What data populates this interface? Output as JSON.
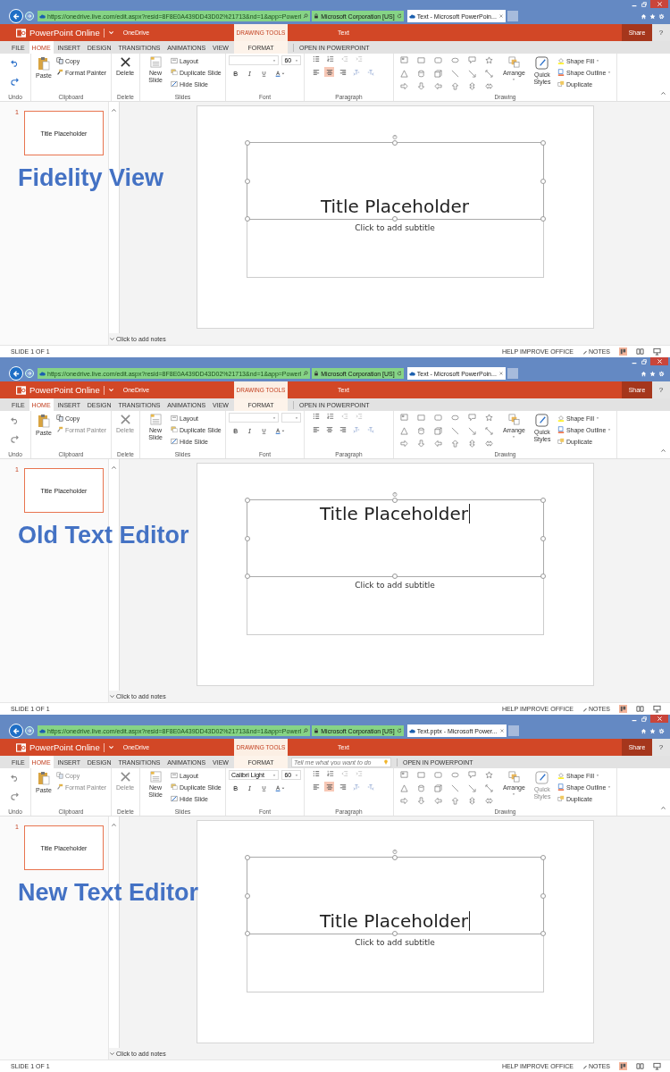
{
  "panels": [
    {
      "caption": "Fidelity View",
      "browser": {
        "url": "https://onedrive.live.com/edit.aspx?resid=8F8E0A439DD43D02%21713&nd=1&app=Powerl",
        "site_identity": "Microsoft Corporation [US]",
        "tab_title": "Text - Microsoft PowerPoin..."
      },
      "app": {
        "name": "PowerPoint Online",
        "location": "OneDrive",
        "context_label": "DRAWING TOOLS",
        "document": "Text",
        "share": "Share",
        "help": "?"
      },
      "tabs": [
        {
          "label": "FILE",
          "kind": "standard",
          "selected": false
        },
        {
          "label": "HOME",
          "kind": "standard",
          "selected": true
        },
        {
          "label": "INSERT",
          "kind": "standard",
          "selected": false
        },
        {
          "label": "DESIGN",
          "kind": "standard",
          "selected": false
        },
        {
          "label": "TRANSITIONS",
          "kind": "standard",
          "selected": false
        },
        {
          "label": "ANIMATIONS",
          "kind": "standard",
          "selected": false
        },
        {
          "label": "VIEW",
          "kind": "standard",
          "selected": false
        },
        {
          "label": "FORMAT",
          "kind": "contextual",
          "selected": false
        }
      ],
      "open_in_app": "OPEN IN POWERPOINT",
      "ribbon": {
        "undo": {
          "label": "Undo",
          "undo_disabled": false,
          "redo_disabled": false
        },
        "clipboard": {
          "label": "Clipboard",
          "paste": {
            "label": "Paste",
            "disabled": false
          },
          "copy": {
            "label": "Copy",
            "disabled": false
          },
          "format_painter": {
            "label": "Format Painter",
            "disabled": false
          }
        },
        "delete": {
          "label": "Delete",
          "button": {
            "label": "Delete",
            "disabled": false
          }
        },
        "slides": {
          "label": "Slides",
          "new_slide": "New Slide",
          "layout": "Layout",
          "duplicate_slide": "Duplicate Slide",
          "hide_slide": "Hide Slide"
        },
        "font": {
          "label": "Font",
          "size": "60"
        },
        "paragraph": {
          "label": "Paragraph",
          "alignment": [
            {
              "kind": "left",
              "selected": false
            },
            {
              "kind": "center",
              "selected": true
            },
            {
              "kind": "right",
              "selected": false
            }
          ]
        },
        "drawing": {
          "label": "Drawing",
          "arrange": "Arrange",
          "quick_styles": {
            "label": "Quick Styles",
            "disabled": false
          },
          "shape_fill": "Shape Fill",
          "shape_outline": "Shape Outline",
          "duplicate": "Duplicate"
        }
      },
      "thumbnail": {
        "number": "1",
        "title": "Title Placeholder"
      },
      "slide": {
        "title": "Title Placeholder",
        "subtitle": "Click to add subtitle",
        "title_at_bottom": true,
        "cursor": false
      },
      "notes": "Click to add notes",
      "status": {
        "slide": "SLIDE 1 OF 1",
        "help": "HELP IMPROVE OFFICE",
        "notes": "NOTES"
      }
    },
    {
      "caption": "Old Text Editor",
      "browser": {
        "url": "https://onedrive.live.com/edit.aspx?resid=8F8E0A439DD43D02%21713&nd=1&app=Powerl",
        "site_identity": "Microsoft Corporation [US]",
        "tab_title": "Text - Microsoft PowerPoin..."
      },
      "app": {
        "name": "PowerPoint Online",
        "location": "OneDrive",
        "context_label": "DRAWING TOOLS",
        "document": "Text",
        "share": "Share",
        "help": "?"
      },
      "tabs": [
        {
          "label": "FILE",
          "kind": "standard",
          "selected": false
        },
        {
          "label": "HOME",
          "kind": "standard",
          "selected": true
        },
        {
          "label": "INSERT",
          "kind": "standard",
          "selected": false
        },
        {
          "label": "DESIGN",
          "kind": "standard",
          "selected": false
        },
        {
          "label": "TRANSITIONS",
          "kind": "standard",
          "selected": false
        },
        {
          "label": "ANIMATIONS",
          "kind": "standard",
          "selected": false
        },
        {
          "label": "VIEW",
          "kind": "standard",
          "selected": false
        },
        {
          "label": "FORMAT",
          "kind": "contextual",
          "selected": false
        }
      ],
      "open_in_app": "OPEN IN POWERPOINT",
      "ribbon": {
        "undo": {
          "label": "Undo",
          "undo_disabled": true,
          "redo_disabled": true
        },
        "clipboard": {
          "label": "Clipboard",
          "paste": {
            "label": "Paste",
            "disabled": false
          },
          "copy": {
            "label": "Copy",
            "disabled": false
          },
          "format_painter": {
            "label": "Format Painter",
            "disabled": true
          }
        },
        "delete": {
          "label": "Delete",
          "button": {
            "label": "Delete",
            "disabled": true
          }
        },
        "slides": {
          "label": "Slides",
          "new_slide": "New Slide",
          "layout": "Layout",
          "duplicate_slide": "Duplicate Slide",
          "hide_slide": "Hide Slide"
        },
        "font": {
          "label": "Font"
        },
        "paragraph": {
          "label": "Paragraph",
          "alignment": [
            {
              "kind": "left",
              "selected": false
            },
            {
              "kind": "center",
              "selected": false
            },
            {
              "kind": "right",
              "selected": false
            }
          ]
        },
        "drawing": {
          "label": "Drawing",
          "arrange": "Arrange",
          "quick_styles": {
            "label": "Quick Styles",
            "disabled": false
          },
          "shape_fill": "Shape Fill",
          "shape_outline": "Shape Outline",
          "duplicate": "Duplicate"
        }
      },
      "thumbnail": {
        "number": "1",
        "title": "Title Placeholder"
      },
      "slide": {
        "title": "Title Placeholder",
        "subtitle": "Click to add subtitle",
        "title_at_bottom": false,
        "cursor": true
      },
      "notes": "Click to add notes",
      "status": {
        "slide": "SLIDE 1 OF 1",
        "help": "HELP IMPROVE OFFICE",
        "notes": "NOTES"
      }
    },
    {
      "caption": "New Text Editor",
      "browser": {
        "url": "https://onedrive.live.com/edit.aspx?resid=8F8E0A439DD43D02%21713&nd=1&app=Powerl",
        "site_identity": "Microsoft Corporation [US]",
        "tab_title": "Text.pptx - Microsoft Power..."
      },
      "app": {
        "name": "PowerPoint Online",
        "location": "OneDrive",
        "context_label": "DRAWING TOOLS",
        "document": "Text",
        "share": "Share",
        "help": "?"
      },
      "tabs": [
        {
          "label": "FILE",
          "kind": "standard",
          "selected": false
        },
        {
          "label": "HOME",
          "kind": "standard",
          "selected": true
        },
        {
          "label": "INSERT",
          "kind": "standard",
          "selected": false
        },
        {
          "label": "DESIGN",
          "kind": "standard",
          "selected": false
        },
        {
          "label": "TRANSITIONS",
          "kind": "standard",
          "selected": false
        },
        {
          "label": "ANIMATIONS",
          "kind": "standard",
          "selected": false
        },
        {
          "label": "VIEW",
          "kind": "standard",
          "selected": false
        },
        {
          "label": "FORMAT",
          "kind": "contextual",
          "selected": false
        }
      ],
      "search": {
        "placeholder": "Tell me what you want to do"
      },
      "open_in_app": "OPEN IN POWERPOINT",
      "ribbon": {
        "undo": {
          "label": "Undo",
          "undo_disabled": true,
          "redo_disabled": true
        },
        "clipboard": {
          "label": "Clipboard",
          "paste": {
            "label": "Paste",
            "disabled": false
          },
          "copy": {
            "label": "Copy",
            "disabled": true
          },
          "format_painter": {
            "label": "Format Painter",
            "disabled": true
          }
        },
        "delete": {
          "label": "Delete",
          "button": {
            "label": "Delete",
            "disabled": true
          }
        },
        "slides": {
          "label": "Slides",
          "new_slide": "New Slide",
          "layout": "Layout",
          "duplicate_slide": "Duplicate Slide",
          "hide_slide": "Hide Slide"
        },
        "font": {
          "label": "Font",
          "name": "Calibri Light",
          "size": "60"
        },
        "paragraph": {
          "label": "Paragraph",
          "alignment": [
            {
              "kind": "left",
              "selected": false
            },
            {
              "kind": "center",
              "selected": true
            },
            {
              "kind": "right",
              "selected": false
            }
          ]
        },
        "drawing": {
          "label": "Drawing",
          "arrange": "Arrange",
          "quick_styles": {
            "label": "Quick Styles",
            "disabled": true
          },
          "shape_fill": "Shape Fill",
          "shape_outline": "Shape Outline",
          "duplicate": "Duplicate"
        }
      },
      "thumbnail": {
        "number": "1",
        "title": "Title Placeholder"
      },
      "slide": {
        "title": "Title Placeholder",
        "subtitle": "Click to add subtitle",
        "title_at_bottom": true,
        "cursor": true
      },
      "notes": "Click to add notes",
      "status": {
        "slide": "SLIDE 1 OF 1",
        "help": "HELP IMPROVE OFFICE",
        "notes": "NOTES"
      }
    }
  ]
}
